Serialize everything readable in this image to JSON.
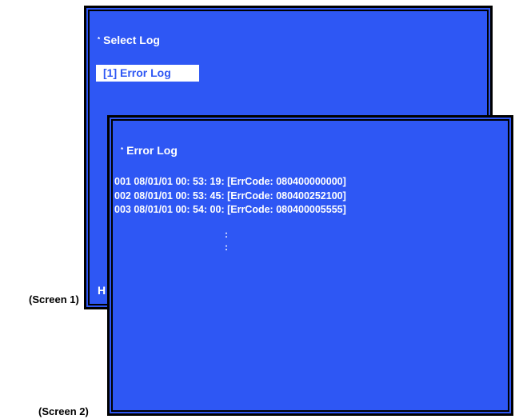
{
  "screen1": {
    "bullet": "*",
    "title": "Select Log",
    "menu_item": "[1] Error Log",
    "cut_off_text": "H",
    "caption": "(Screen 1)"
  },
  "screen2": {
    "bullet": "*",
    "title": "Error Log",
    "log_entries": [
      "001 08/01/01 00: 53: 19: [ErrCode: 080400000000]",
      "002 08/01/01 00: 53: 45: [ErrCode: 080400252100]",
      "003 08/01/01 00: 54: 00: [ErrCode: 080400005555]"
    ],
    "continuation": [
      ":",
      ":"
    ],
    "caption": "(Screen 2)"
  },
  "colors": {
    "screen_bg": "#2e57f4",
    "border": "#000000",
    "text": "#ffffff",
    "highlight_bg": "#ffffff",
    "highlight_text": "#2e57f4"
  }
}
